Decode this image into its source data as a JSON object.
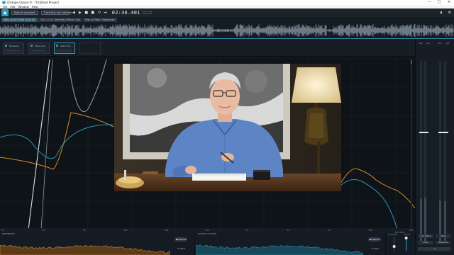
{
  "window": {
    "title": "iZotope Ozone 9 - *Untitled Project",
    "minimize": "—",
    "maximize": "□",
    "close": "✕"
  },
  "menu": [
    "File",
    "Edit",
    "Window",
    "Help"
  ],
  "transport": {
    "mode_button": "Module Assistant",
    "track_name": "Time Exp, Join Interval",
    "timecode": "02:36.401",
    "time_format_line1": "h:m:s.ms",
    "time_format_line2": "44.1 kHz",
    "icons": [
      "rewind-icon",
      "play-icon",
      "stop-icon",
      "record-icon",
      "loop-icon",
      "skip-end-icon"
    ]
  },
  "clips": [
    {
      "label": "2021-10-15 TV Ad 23:14 (2)",
      "active": true
    },
    {
      "label": "2021-11-01_TeamTalk (Offline)_(hh)",
      "active": false
    },
    {
      "label": "Pres_v4 Take 2 Ready.wav",
      "active": false
    }
  ],
  "modules": [
    {
      "label": "Equalizer",
      "active": false
    },
    {
      "label": "Maximizer",
      "active": false
    },
    {
      "label": "Match EQ",
      "active": true
    }
  ],
  "freq_axis": [
    "Hz",
    "20",
    "50",
    "100",
    "200",
    "500",
    "1k",
    "2k",
    "5k",
    "10k",
    "20k"
  ],
  "capture_panels": [
    {
      "label": "REFERENCE",
      "capture": "Capture",
      "clear": "Clear"
    },
    {
      "label": "SOURCE (ACTIVE)",
      "capture": "Capture",
      "clear": "Clear"
    }
  ],
  "fine_tune": {
    "title": "Fine Tune",
    "left_label": "Smoothing",
    "right_label": "Amount"
  },
  "meters": {
    "heads": [
      "-0.9",
      "-0.9",
      "-0.3",
      "-0.3"
    ],
    "buttons": [
      "Gain Match",
      "Dither",
      "Codec",
      "Reference"
    ]
  },
  "colors": {
    "accent": "#2a98b8",
    "reference_curve": "#d78a2c",
    "source_curve": "#2f8fb0",
    "eq_curve": "#d9dde0"
  }
}
